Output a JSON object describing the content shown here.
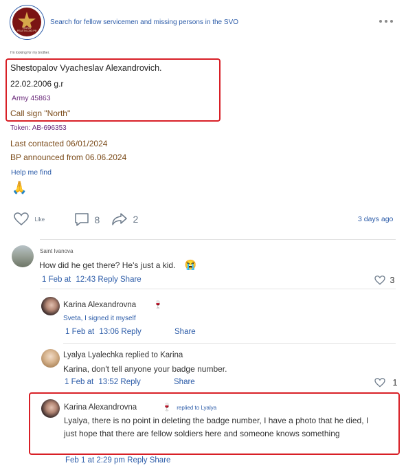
{
  "header": {
    "group_name": "Search for fellow servicemen and missing persons in the SVO",
    "logo_text": "ПОИСК\nРЕАЛТИ-СВО.РФ",
    "more_icon": "more-dots-icon"
  },
  "post": {
    "intro": "I'm looking for my brother.",
    "name": "Shestopalov Vyacheslav Alexandrovich.",
    "dob": "22.02.2006 g.r",
    "army": "Army 45863",
    "call_sign": "Call sign \"North\"",
    "token": "Token: AB-696353",
    "last_contacted": "Last contacted 06/01/2024",
    "bp_announced": "BP announced from 06.06.2024",
    "help_link": "Help me find",
    "emoji": "🙏",
    "actions": {
      "like_label": "Like",
      "comments_count": "8",
      "shares_count": "2",
      "time": "3 days ago"
    }
  },
  "comments": [
    {
      "author": "Saint Ivanova",
      "text": "How did he get there? He's just a kid.",
      "emoji": "😭",
      "date": "1 Feb at",
      "time": "12:43",
      "reply": "Reply",
      "share": "Share",
      "likes": "3"
    },
    {
      "author": "Karina Alexandrovna",
      "emoji": "🍷",
      "text": "Sveta, I signed it myself",
      "date": "1 Feb at",
      "time": "13:06",
      "reply": "Reply",
      "share": "Share"
    },
    {
      "author": "Lyalya Lyalechka replied to Karina",
      "text": "Karina, don't tell anyone your badge number.",
      "date": "1 Feb at",
      "time": "13:52",
      "reply": "Reply",
      "share": "Share",
      "likes": "1"
    },
    {
      "author": "Karina Alexandrovna",
      "emoji": "🍷",
      "replied_to": "replied to Lyalya",
      "text_line1": "Lyalya, there is no point in deleting the badge number, I have a photo that he died, I",
      "text_line2": "just hope that there are fellow soldiers here and someone knows something",
      "footer": "Feb 1 at 2:29 pm Reply Share"
    }
  ],
  "colors": {
    "accent_blue": "#2b5ba8",
    "highlight_red": "#d81f26",
    "purple_text": "#6a2a7a",
    "brown_text": "#7a4a18"
  }
}
